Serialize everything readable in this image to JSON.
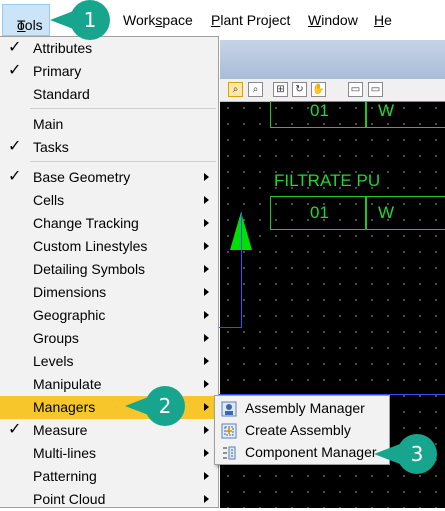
{
  "menubar": {
    "items": [
      {
        "label": "Tools",
        "accel": "T",
        "rest": "ools"
      },
      {
        "label": "Workspace",
        "pre": "Work",
        "accel": "s",
        "rest": "pace"
      },
      {
        "label": "Plant Project",
        "accel": "P",
        "rest": "lant Project"
      },
      {
        "label": "Window",
        "accel": "W",
        "rest": "indow"
      },
      {
        "label": "He",
        "accel": "H",
        "rest": "e"
      }
    ]
  },
  "cad": {
    "texts": [
      "01",
      "W",
      "FILTRATE PU",
      "01",
      "W"
    ]
  },
  "tools_menu": {
    "items": [
      {
        "label": "Attributes",
        "checked": true
      },
      {
        "label": "Primary",
        "checked": true
      },
      {
        "label": "Standard",
        "checked": false
      },
      {
        "label": "Main",
        "checked": false
      },
      {
        "label": "Tasks",
        "checked": true
      },
      {
        "label": "Base Geometry",
        "checked": true
      },
      {
        "label": "Cells"
      },
      {
        "label": "Change Tracking"
      },
      {
        "label": "Custom Linestyles"
      },
      {
        "label": "Detailing Symbols"
      },
      {
        "label": "Dimensions"
      },
      {
        "label": "Geographic"
      },
      {
        "label": "Groups"
      },
      {
        "label": "Levels"
      },
      {
        "label": "Manipulate"
      },
      {
        "label": "Managers",
        "highlighted": true
      },
      {
        "label": "Measure",
        "checked": true
      },
      {
        "label": "Multi-lines"
      },
      {
        "label": "Patterning"
      },
      {
        "label": "Point Cloud"
      }
    ],
    "check_glyph": "✓"
  },
  "managers_submenu": {
    "items": [
      {
        "label": "Assembly Manager",
        "icon": "assembly-manager-icon"
      },
      {
        "label": "Create Assembly",
        "icon": "create-assembly-icon"
      },
      {
        "label": "Component Manager",
        "icon": "component-manager-icon"
      }
    ]
  },
  "callouts": [
    "1",
    "2",
    "3"
  ],
  "colors": {
    "highlight": "#f7c62a",
    "callout": "#17a68d",
    "cad_green": "#22d62e",
    "cad_blue": "#3a4bff"
  }
}
